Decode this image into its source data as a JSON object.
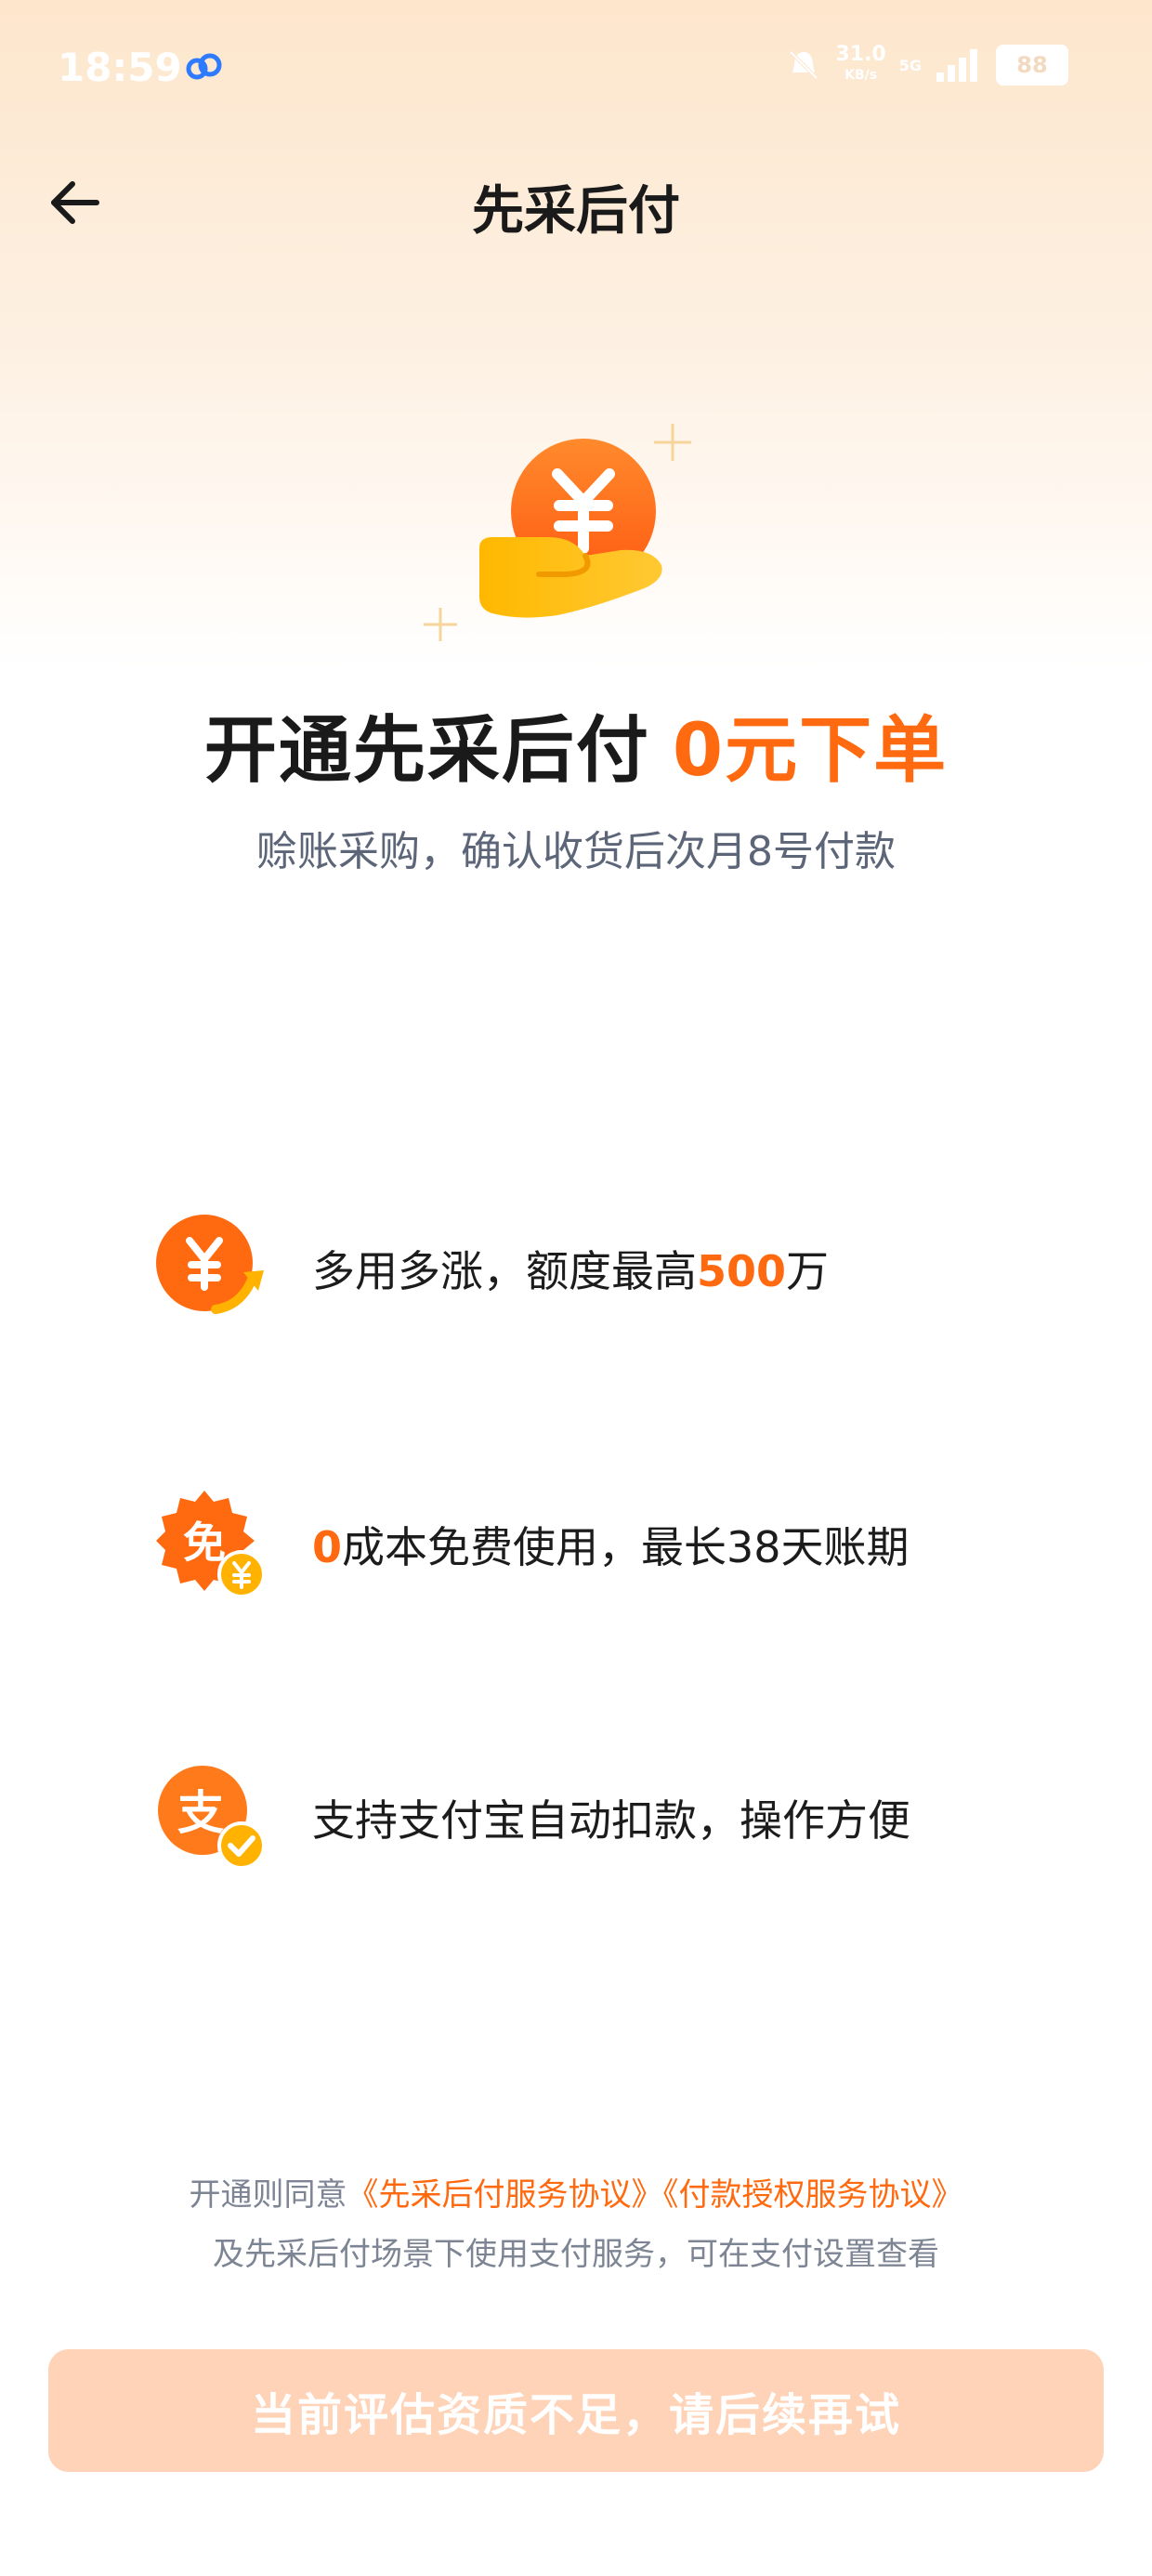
{
  "status_bar": {
    "time": "18:59",
    "net_speed": "31.0",
    "net_speed_unit": "KB/s",
    "network": "5G",
    "battery": "88"
  },
  "nav": {
    "title": "先采后付"
  },
  "hero": {
    "headline_main": "开通先采后付",
    "headline_accent": "0元下单",
    "subline": "赊账采购，确认收货后次月8号付款"
  },
  "features": [
    {
      "icon": "yen-growth-icon",
      "pre": "多用多涨，额度最高",
      "hl": "500",
      "post": "万"
    },
    {
      "icon": "free-badge-icon",
      "pre": "",
      "hl": "0",
      "post": "成本免费使用，最长38天账期"
    },
    {
      "icon": "alipay-check-icon",
      "pre": "支持支付宝自动扣款，操作方便",
      "hl": "",
      "post": ""
    }
  ],
  "agreement": {
    "prefix": "开通则同意",
    "link1": "《先采后付服务协议》",
    "link2": "《付款授权服务协议》",
    "line2": "及先采后付场景下使用支付服务，可在支付设置查看"
  },
  "cta": {
    "label": "当前评估资质不足，请后续再试"
  },
  "colors": {
    "accent": "#ff6a10",
    "cta_disabled": "#fed3b8",
    "coin": "#ff7a1a",
    "hand": "#ffb300"
  }
}
